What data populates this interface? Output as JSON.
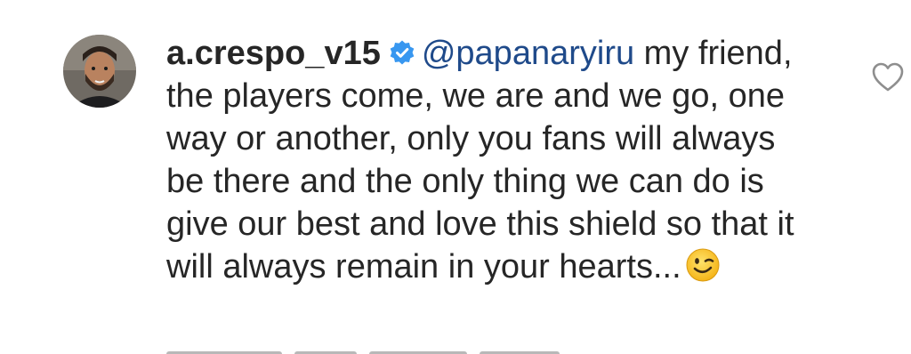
{
  "comment": {
    "username": "a.crespo_v15",
    "verified": true,
    "mention": "@papanaryiru",
    "text": "my friend, the players come, we are and we go, one way or another, only you fans will always be there and the only thing we can do is give our best and love this shield so that it will always remain in your hearts...",
    "emoji": "winking-face",
    "avatar": "profile-photo"
  },
  "icons": {
    "verified": "verified-badge-icon",
    "like": "heart-outline-icon"
  },
  "colors": {
    "text": "#262626",
    "mention": "#1f4a8a",
    "verified": "#3897f0",
    "like_outline": "#8e8e8e"
  }
}
